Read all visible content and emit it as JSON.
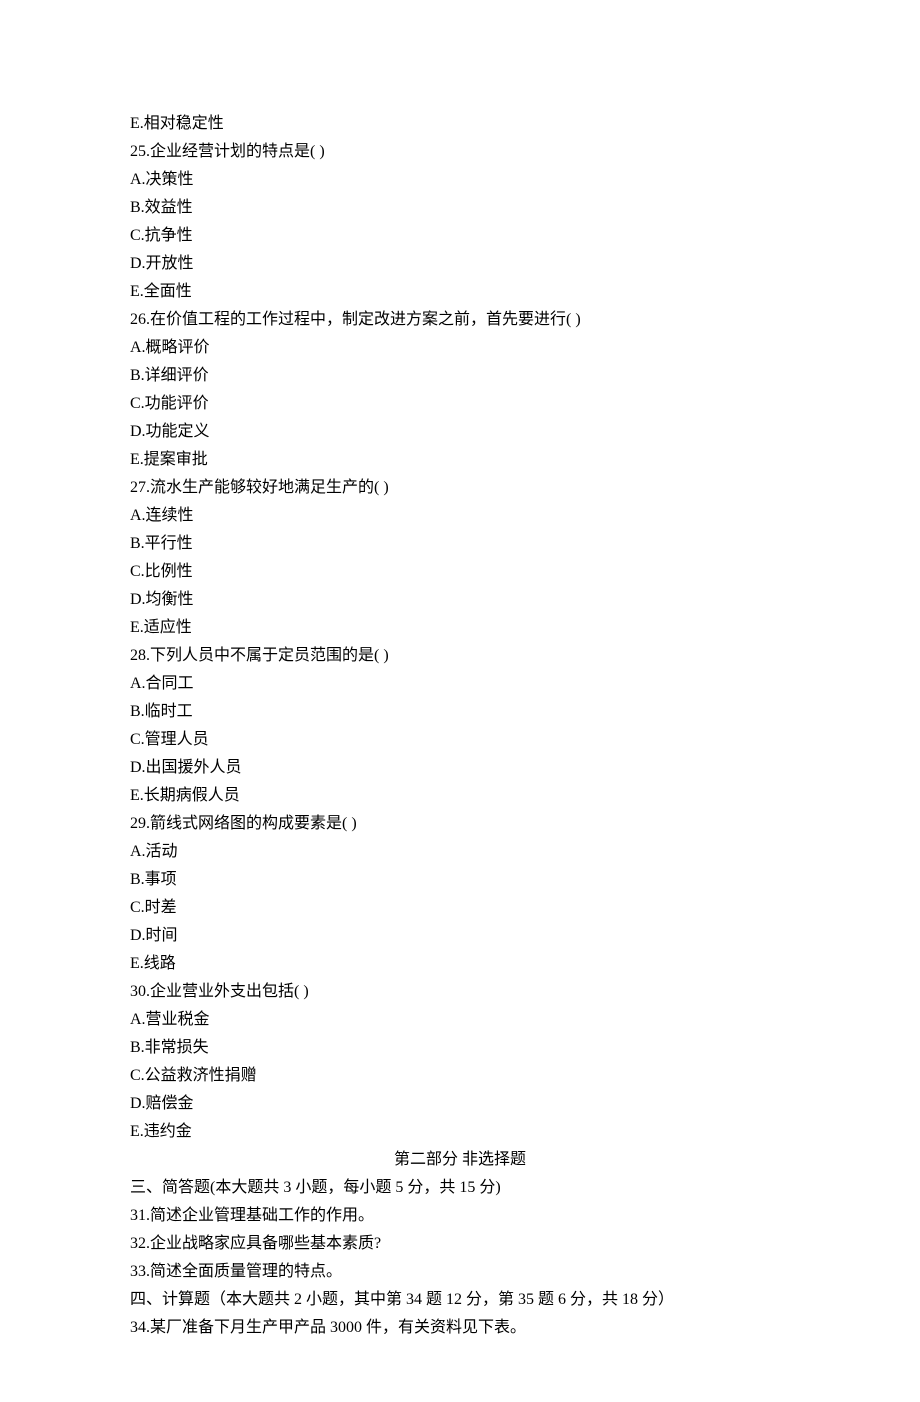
{
  "lines": [
    "E.相对稳定性",
    "25.企业经营计划的特点是( )",
    "A.决策性",
    "B.效益性",
    "C.抗争性",
    "D.开放性",
    "E.全面性",
    "26.在价值工程的工作过程中，制定改进方案之前，首先要进行( )",
    "A.概略评价",
    "B.详细评价",
    "C.功能评价",
    "D.功能定义",
    "E.提案审批",
    "27.流水生产能够较好地满足生产的( )",
    "A.连续性",
    "B.平行性",
    "C.比例性",
    "D.均衡性",
    "E.适应性",
    "28.下列人员中不属于定员范围的是( )",
    "A.合同工",
    "B.临时工",
    "C.管理人员",
    "D.出国援外人员",
    "E.长期病假人员",
    "29.箭线式网络图的构成要素是( )",
    "A.活动",
    "B.事项",
    "C.时差",
    "D.时间",
    "E.线路",
    "30.企业营业外支出包括( )",
    "A.营业税金",
    "B.非常损失",
    "C.公益救济性捐赠",
    "D.赔偿金",
    "E.违约金"
  ],
  "section_header": "第二部分 非选择题",
  "section3": {
    "title": "三、简答题(本大题共 3 小题，每小题 5 分，共 15 分)",
    "q31": "31.简述企业管理基础工作的作用。",
    "q32": "32.企业战略家应具备哪些基本素质?",
    "q33": "33.简述全面质量管理的特点。"
  },
  "section4": {
    "title": "四、计算题（本大题共 2 小题，其中第 34 题 12 分，第 35 题 6 分，共 18 分）",
    "q34": "34.某厂准备下月生产甲产品 3000 件，有关资料见下表。"
  }
}
